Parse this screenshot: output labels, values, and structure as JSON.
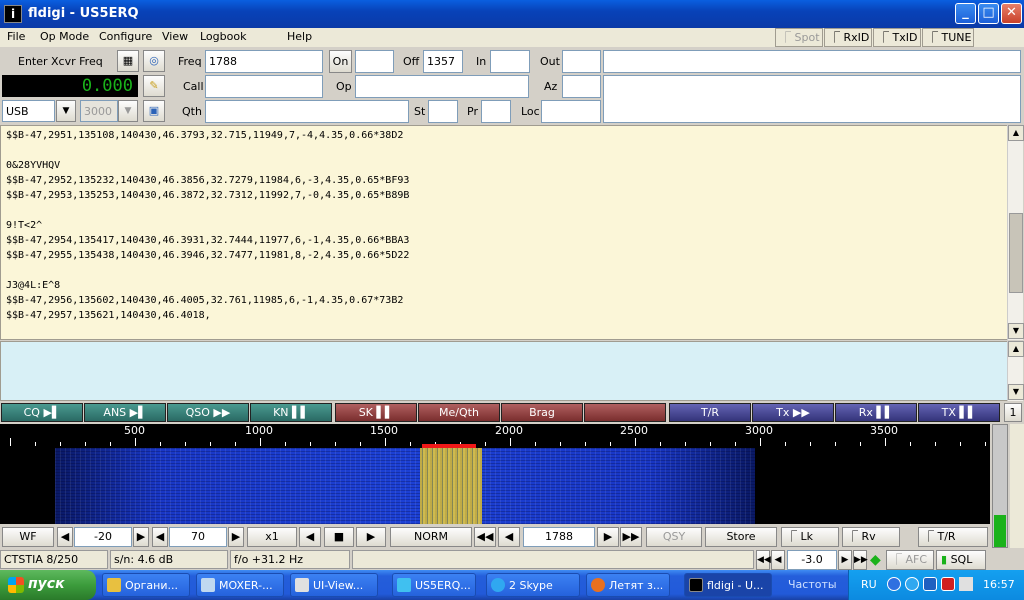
{
  "window": {
    "title": "fldigi - US5ERQ"
  },
  "menu": [
    "File",
    "Op Mode",
    "Configure",
    "View",
    "Logbook",
    "Help"
  ],
  "toggles": {
    "spot": "Spot",
    "rxid": "RxID",
    "txid": "TxID",
    "tune": "TUNE"
  },
  "xcvr": {
    "enter_label": "Enter Xcvr Freq",
    "freq_display": "0.000",
    "mode": "USB",
    "bandwidth": "3000"
  },
  "log": {
    "freq_label": "Freq",
    "freq": "1788",
    "on_label": "On",
    "on": "",
    "off_label": "Off",
    "off": "1357",
    "in_label": "In",
    "in": "",
    "out_label": "Out",
    "out": "",
    "call_label": "Call",
    "call": "",
    "op_label": "Op",
    "op": "",
    "az_label": "Az",
    "az": "",
    "qth_label": "Qth",
    "qth": "",
    "st_label": "St",
    "st": "",
    "pr_label": "Pr",
    "pr": "",
    "loc_label": "Loc",
    "loc": ""
  },
  "rx_text": "$$B-47,2951,135108,140430,46.3793,32.715,11949,7,-4,4.35,0.66*38D2\n\n0&28YVHQV\n$$B-47,2952,135232,140430,46.3856,32.7279,11984,6,-3,4.35,0.65*BF93\n$$B-47,2953,135253,140430,46.3872,32.7312,11992,7,-0,4.35,0.65*B89B\n\n9!T<2^\n$$B-47,2954,135417,140430,46.3931,32.7444,11977,6,-1,4.35,0.66*BBA3\n$$B-47,2955,135438,140430,46.3946,32.7477,11981,8,-2,4.35,0.66*5D22\n\nJ3@4L:E^8\n$$B-47,2956,135602,140430,46.4005,32.761,11985,6,-1,4.35,0.67*73B2\n$$B-47,2957,135621,140430,46.4018,",
  "macros": [
    {
      "label": "CQ ▶▌"
    },
    {
      "label": "ANS ▶▌"
    },
    {
      "label": "QSO ▶▶"
    },
    {
      "label": "KN ▌▌"
    },
    {
      "label": "SK ▌▌"
    },
    {
      "label": "Me/Qth"
    },
    {
      "label": "Brag"
    },
    {
      "label": ""
    },
    {
      "label": "T/R"
    },
    {
      "label": "Tx ▶▶"
    },
    {
      "label": "Rx ▌▌"
    },
    {
      "label": "TX ▌▌"
    }
  ],
  "macro_page": "1",
  "ruler_labels": [
    "500",
    "1000",
    "1500",
    "2000",
    "2500",
    "3000",
    "3500"
  ],
  "controls": {
    "wf": "WF",
    "ref": "-20",
    "range": "70",
    "zoom": "x1",
    "norm": "NORM",
    "freq": "1788",
    "qsy": "QSY",
    "store": "Store",
    "lk": "Lk",
    "rv": "Rv",
    "tr": "T/R"
  },
  "status": {
    "mode": "CTSTIA 8/250",
    "sn": "s/n:  4.6 dB",
    "fo": "f/o +31.2 Hz",
    "sql_value": "-3.0",
    "afc": "AFC",
    "sql": "SQL"
  },
  "taskbar": {
    "start": "пуск",
    "tasks": [
      "Органи...",
      "MOXER-...",
      "UI-View...",
      "US5ERQ...",
      "2 Skype",
      "Летят з...",
      "fldigi - U...",
      "Частоты"
    ],
    "lang": "RU",
    "clock": "16:57"
  }
}
